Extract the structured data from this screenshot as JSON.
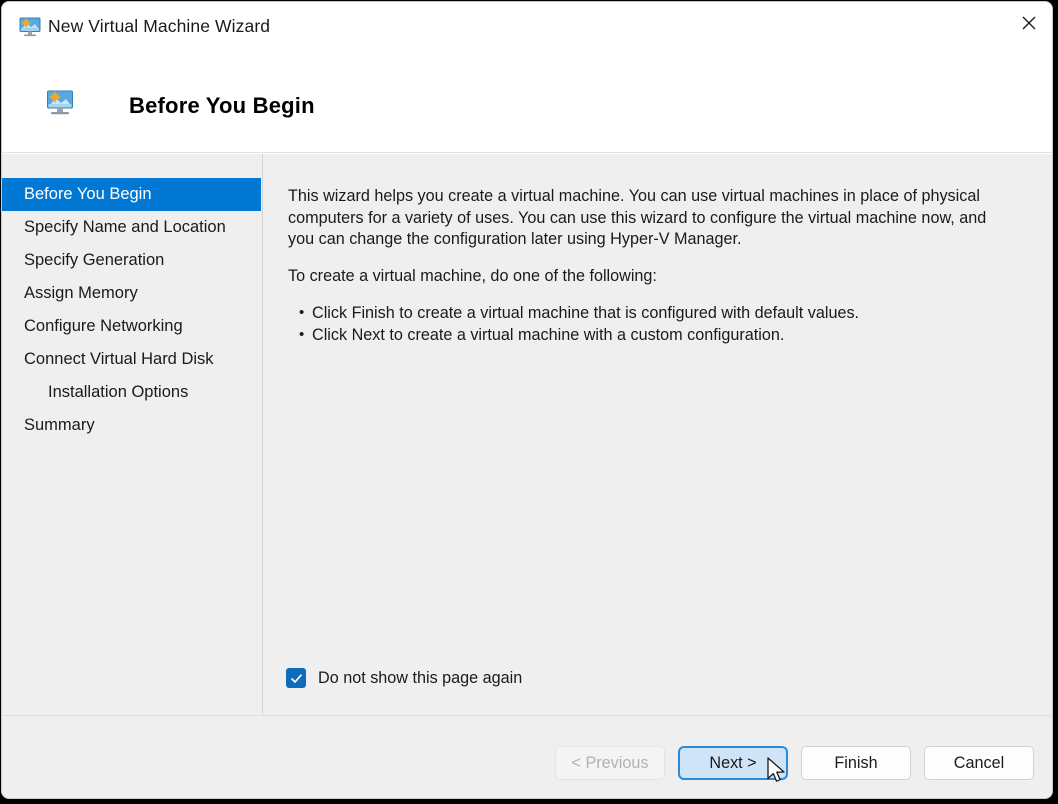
{
  "window": {
    "title": "New Virtual Machine Wizard",
    "title_icon": "virtual-machine-icon",
    "close_icon": "close-icon"
  },
  "header": {
    "icon": "before-you-begin-icon",
    "title": "Before You Begin"
  },
  "sidebar": {
    "items": [
      {
        "label": "Before You Begin",
        "selected": true,
        "indented": false
      },
      {
        "label": "Specify Name and Location",
        "selected": false,
        "indented": false
      },
      {
        "label": "Specify Generation",
        "selected": false,
        "indented": false
      },
      {
        "label": "Assign Memory",
        "selected": false,
        "indented": false
      },
      {
        "label": "Configure Networking",
        "selected": false,
        "indented": false
      },
      {
        "label": "Connect Virtual Hard Disk",
        "selected": false,
        "indented": false
      },
      {
        "label": "Installation Options",
        "selected": false,
        "indented": true
      },
      {
        "label": "Summary",
        "selected": false,
        "indented": false
      }
    ],
    "selected_color": "#0078d4"
  },
  "content": {
    "paragraph1": "This wizard helps you create a virtual machine. You can use virtual machines in place of physical computers for a variety of uses. You can use this wizard to configure the virtual machine now, and you can change the configuration later using Hyper-V Manager.",
    "paragraph2": "To create a virtual machine, do one of the following:",
    "bullets": [
      "Click Finish to create a virtual machine that is configured with default values.",
      "Click Next to create a virtual machine with a custom configuration."
    ],
    "checkbox": {
      "label": "Do not show this page again",
      "checked": true,
      "color": "#0f6cbd"
    }
  },
  "footer": {
    "previous_label": "< Previous",
    "previous_enabled": false,
    "next_label": "Next >",
    "next_focused": true,
    "next_accent": "#2e8ad6",
    "finish_label": "Finish",
    "cancel_label": "Cancel"
  }
}
